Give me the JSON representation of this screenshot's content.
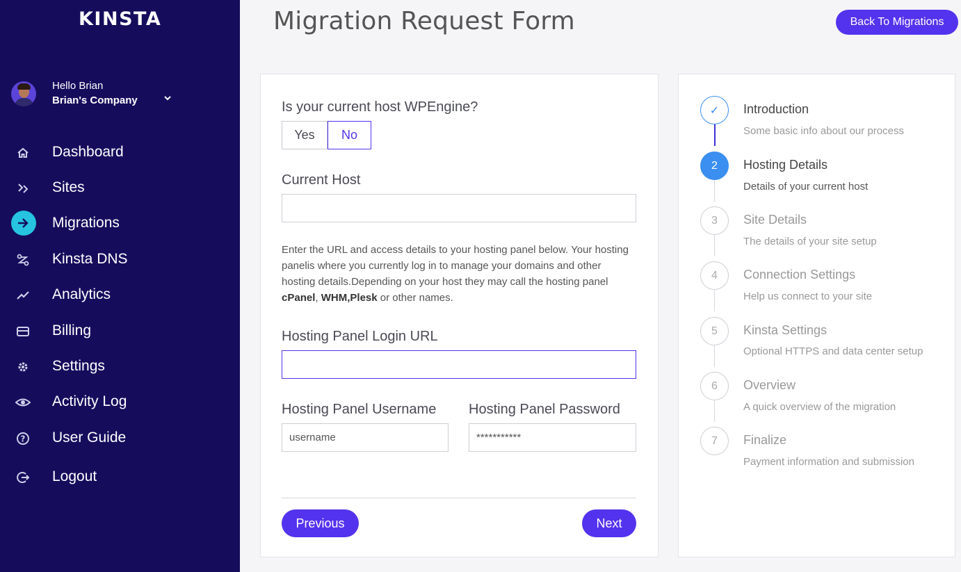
{
  "sidebar": {
    "logo": "KINSTA",
    "user": {
      "greeting": "Hello Brian",
      "company": "Brian's Company"
    },
    "items": [
      {
        "label": "Dashboard",
        "icon": "home-icon"
      },
      {
        "label": "Sites",
        "icon": "sites-icon"
      },
      {
        "label": "Migrations",
        "icon": "migrations-icon",
        "active": true
      },
      {
        "label": "Kinsta DNS",
        "icon": "dns-icon"
      },
      {
        "label": "Analytics",
        "icon": "analytics-icon"
      },
      {
        "label": "Billing",
        "icon": "billing-icon"
      },
      {
        "label": "Settings",
        "icon": "gear-icon"
      },
      {
        "label": "Activity Log",
        "icon": "eye-icon"
      },
      {
        "label": "User Guide",
        "icon": "help-icon"
      },
      {
        "label": "Logout",
        "icon": "logout-icon"
      }
    ]
  },
  "header": {
    "title": "Migration Request Form",
    "back_label": "Back To Migrations"
  },
  "form": {
    "question": "Is your current host WPEngine?",
    "yes_label": "Yes",
    "no_label": "No",
    "selected": "No",
    "current_host_label": "Current Host",
    "current_host_value": "",
    "help_text_1": "Enter the URL and access details to your hosting panel below. Your hosting panelis where you currently log in to manage your domains and other hosting details.Depending on your host they may call the hosting panel ",
    "help_cpanel": "cPanel",
    "help_sep": ", ",
    "help_whm": "WHM",
    "help_comma": ",",
    "help_plesk": "Plesk",
    "help_text_2": " or other names.",
    "login_url_label": "Hosting Panel Login URL",
    "login_url_value": "",
    "username_label": "Hosting Panel Username",
    "username_placeholder": "username",
    "password_label": "Hosting Panel Password",
    "password_placeholder": "***********",
    "previous_label": "Previous",
    "next_label": "Next"
  },
  "steps": [
    {
      "number": "✓",
      "title": "Introduction",
      "subtitle": "Some basic info about our process",
      "state": "done"
    },
    {
      "number": "2",
      "title": "Hosting Details",
      "subtitle": "Details of your current host",
      "state": "current"
    },
    {
      "number": "3",
      "title": "Site Details",
      "subtitle": "The details of your site setup",
      "state": "pending"
    },
    {
      "number": "4",
      "title": "Connection Settings",
      "subtitle": "Help us connect to your site",
      "state": "pending"
    },
    {
      "number": "5",
      "title": "Kinsta Settings",
      "subtitle": "Optional HTTPS and data center setup",
      "state": "pending"
    },
    {
      "number": "6",
      "title": "Overview",
      "subtitle": "A quick overview of the migration",
      "state": "pending"
    },
    {
      "number": "7",
      "title": "Finalize",
      "subtitle": "Payment information and submission",
      "state": "pending"
    }
  ],
  "colors": {
    "sidebar": "#150d5c",
    "accent": "#5333ed",
    "step_blue": "#3b8ff0",
    "active_nav": "#26c4e0"
  }
}
